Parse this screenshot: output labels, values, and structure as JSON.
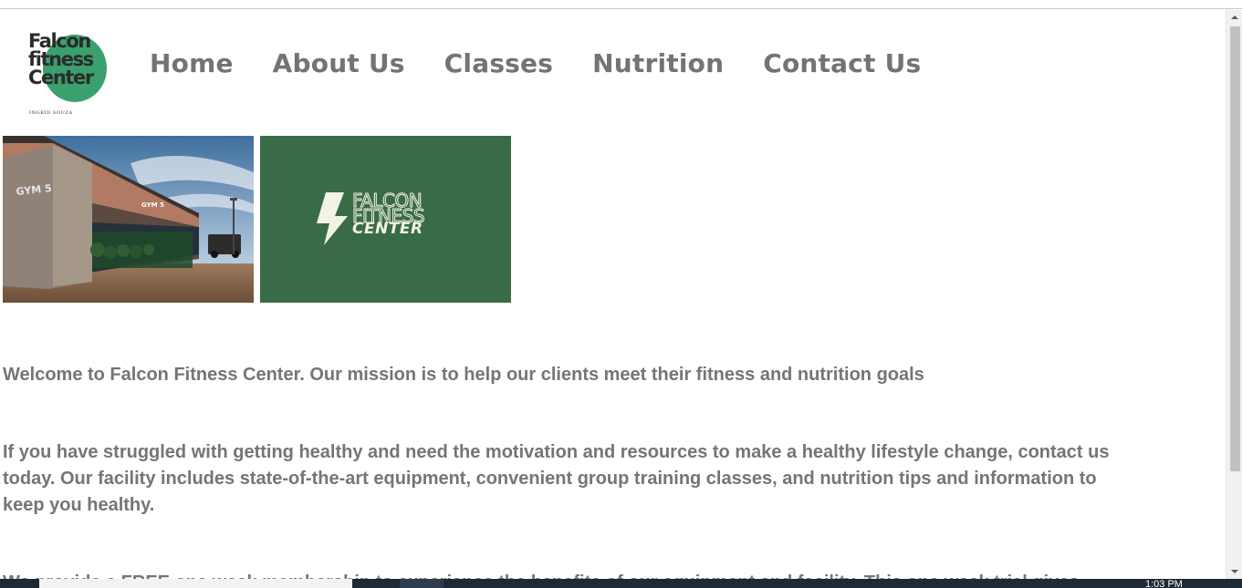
{
  "logo": {
    "line1": "Falcon",
    "line2": "fitness",
    "line3": "Center",
    "subtitle": "INGRID SOUZA"
  },
  "nav": {
    "items": [
      {
        "label": "Home"
      },
      {
        "label": "About Us"
      },
      {
        "label": "Classes"
      },
      {
        "label": "Nutrition"
      },
      {
        "label": "Contact Us"
      }
    ]
  },
  "images": {
    "photo_sign": "GYM 5",
    "photo_sign2": "GYM 5",
    "card_line1": "FALCON",
    "card_line2": "FITNESS",
    "card_line3": "CENTER"
  },
  "content": {
    "paragraph1": "Welcome to Falcon Fitness Center. Our mission is to help our clients meet their fitness and nutrition goals",
    "paragraph2": "If you have struggled with getting healthy and need the motivation and resources to make a healthy lifestyle change, contact us today. Our facility includes state-of-the-art equipment, convenient group training classes, and nutrition tips and information to keep you healthy.",
    "paragraph3": "We provide a FREE one week membership to experience the benefits of our equipment and facility. This one week trial gives"
  },
  "taskbar": {
    "clock": "1:03 PM"
  },
  "colors": {
    "nav_text": "#737373",
    "body_text": "#757575",
    "logo_green": "#3aa06d",
    "card_green": "#3a6b47"
  }
}
